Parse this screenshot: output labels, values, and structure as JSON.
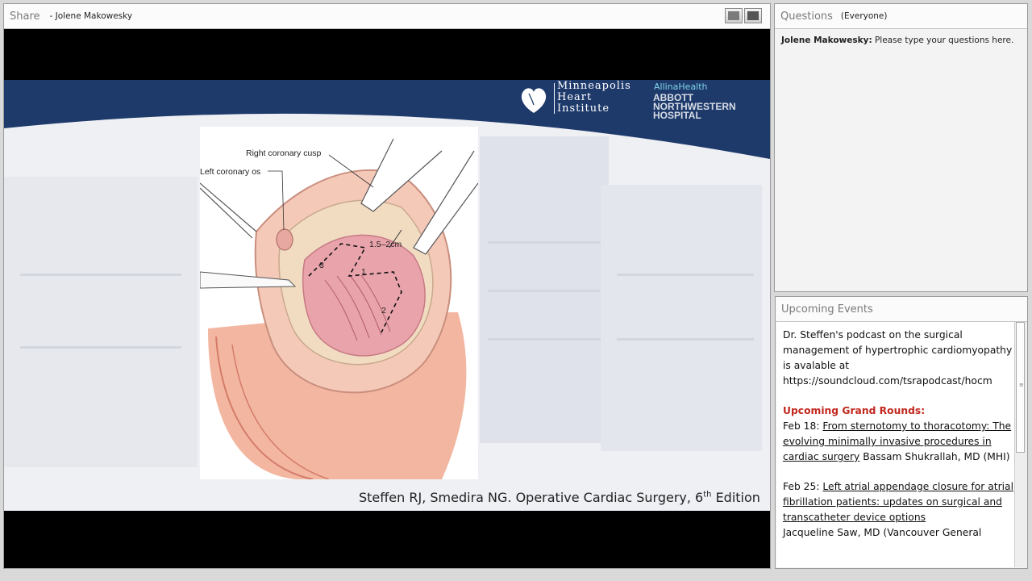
{
  "share": {
    "title": "Share",
    "presenter": "- Jolene Makowesky"
  },
  "slide": {
    "org_line1": "Minneapolis",
    "org_line2": "Heart",
    "org_line3": "Institute",
    "allina": "AllinaHealth",
    "hospital_line1": "ABBOTT",
    "hospital_line2": "NORTHWESTERN",
    "hospital_line3": "HOSPITAL",
    "labels": {
      "right_cusp": "Right coronary cusp",
      "left_os": "Left coronary os",
      "measure": "1.5–2cm",
      "n1": "1",
      "n2": "2",
      "n3": "3"
    },
    "citation_main": "Steffen RJ, Smedira NG.  Operative Cardiac Surgery, 6",
    "citation_sup": "th",
    "citation_end": " Edition"
  },
  "questions": {
    "title": "Questions",
    "audience": "(Everyone)",
    "message_author": "Jolene Makowesky:",
    "message_text": " Please type your questions here."
  },
  "events": {
    "title": "Upcoming Events",
    "podcast_text": "Dr. Steffen's podcast on the surgical management of hypertrophic cardiomyopathy is avalable at https://soundcloud.com/tsrapodcast/hocm",
    "grand_rounds_heading": "Upcoming Grand Rounds:",
    "item1_date": "Feb 18: ",
    "item1_title": "From sternotomy to thoracotomy: The evolving minimally invasive procedures in cardiac surgery",
    "item1_speaker": " Bassam Shukrallah, MD (MHI)",
    "item2_date": "Feb 25: ",
    "item2_title": "Left atrial appendage closure for atrial fibrillation patients: updates on surgical and transcatheter device options",
    "item2_speaker": "Jacqueline Saw, MD (Vancouver General"
  },
  "colors": {
    "banner_blue": "#1e3a6b",
    "grand_rounds_red": "#c2281f"
  }
}
